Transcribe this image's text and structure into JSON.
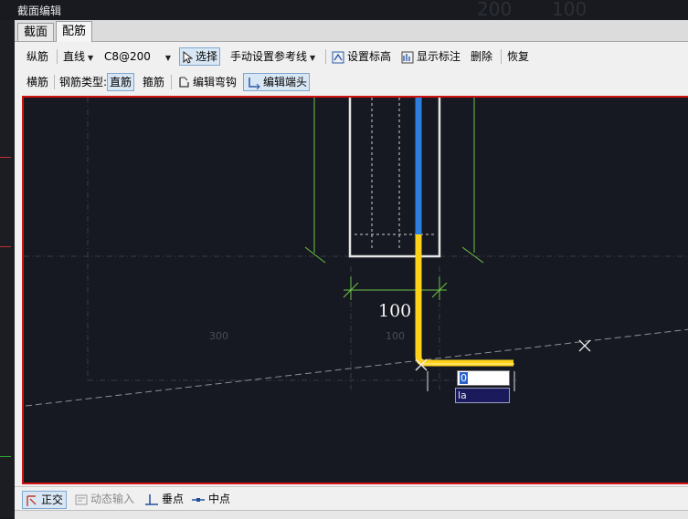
{
  "window": {
    "title": "截面编辑",
    "background_numbers": [
      "200",
      "100"
    ]
  },
  "tabs": [
    {
      "label": "截面",
      "active": false
    },
    {
      "label": "配筋",
      "active": true
    }
  ],
  "toolbar1": {
    "longitudinal": "纵筋",
    "line_mode": "直线",
    "spec": "C8@200",
    "select": "选择",
    "manual_ref": "手动设置参考线",
    "set_elevation": "设置标高",
    "show_dims": "显示标注",
    "delete": "删除",
    "restore": "恢复"
  },
  "toolbar2": {
    "transverse": "横筋",
    "rebar_type_label": "钢筋类型:",
    "straight": "直筋",
    "stirrup": "箍筋",
    "edit_hook": "编辑弯钩",
    "edit_end": "编辑端头"
  },
  "canvas": {
    "dim_main": "100",
    "dim_left": "300",
    "dim_center": "100",
    "input_value": "0",
    "hint_text": "la"
  },
  "statusbar": {
    "ortho": "正交",
    "dynamic_input": "动态输入",
    "perpendicular": "垂点",
    "midpoint": "中点"
  },
  "colors": {
    "canvas_bg": "#161921",
    "frame_red": "#d01212",
    "rebar_yellow": "#ffd21a",
    "rebar_blue": "#2a7fe0",
    "dim_green": "#6fc24a"
  }
}
